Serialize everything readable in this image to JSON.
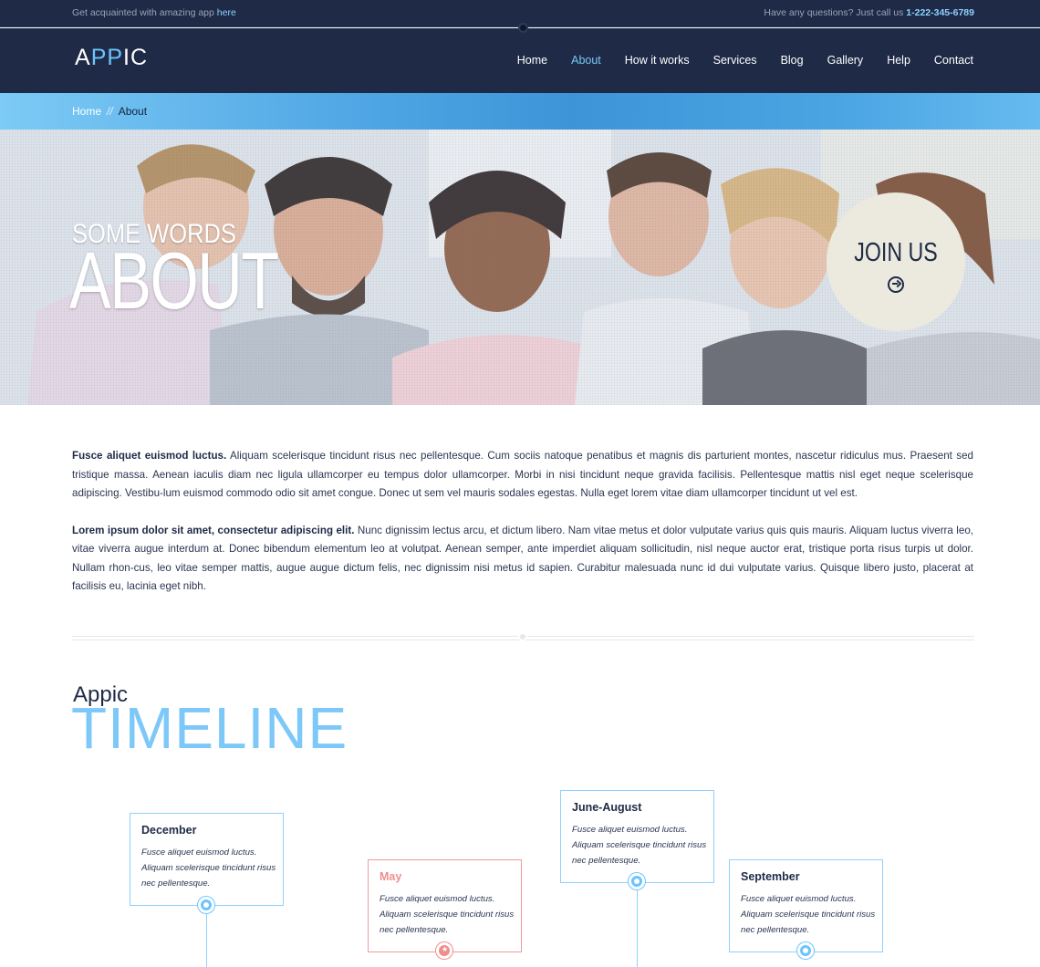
{
  "topbar": {
    "left_text": "Get acquainted with amazing app ",
    "left_link": "here",
    "right_text": "Have any questions? Just call us ",
    "phone": "1-222-345-6789"
  },
  "header": {
    "logo_a": "A",
    "logo_pp": "PP",
    "logo_ic": "IC",
    "nav": [
      "Home",
      "About",
      "How it works",
      "Services",
      "Blog",
      "Gallery",
      "Help",
      "Contact"
    ],
    "active_nav": "About"
  },
  "breadcrumb": {
    "home": "Home",
    "separator": "//",
    "current": "About"
  },
  "hero": {
    "line1": "SOME WORDS",
    "line2": "ABOUT",
    "join_label": "JOIN US",
    "join_icon": "arrow-right-circle-icon"
  },
  "content": {
    "p1_bold": "Fusce aliquet euismod luctus.",
    "p1_text": " Aliquam scelerisque tincidunt risus nec pellentesque. Cum sociis natoque penatibus et magnis dis parturient montes, nascetur ridiculus mus. Praesent sed tristique massa. Aenean iaculis diam nec ligula ullamcorper eu tempus dolor ullamcorper. Morbi in nisi tincidunt neque gravida facilisis.  Pellentesque mattis nisl eget neque scelerisque adipiscing. Vestibu-lum euismod commodo odio sit amet congue. Donec ut sem vel mauris sodales egestas. Nulla eget lorem vitae diam ullamcorper tincidunt ut vel est.",
    "p2_bold": "Lorem ipsum dolor sit amet, consectetur adipiscing elit.",
    "p2_text": " Nunc dignissim lectus arcu, et dictum libero. Nam vitae metus et dolor vulputate varius quis quis mauris. Aliquam luctus viverra leo, vitae viverra augue interdum at. Donec bibendum elementum leo at volutpat. Aenean semper, ante imperdiet aliquam sollicitudin, nisl neque auctor erat, tristique porta risus turpis ut dolor. Nullam rhon-cus, leo vitae semper mattis, augue augue dictum felis, nec dignissim nisi metus id sapien. Curabitur malesuada nunc id dui vulputate varius. Quisque libero justo, placerat at facilisis eu, lacinia eget nibh."
  },
  "timeline": {
    "small": "Appic",
    "big": "TIMELINE",
    "cards": [
      {
        "title": "December",
        "text": "Fusce aliquet euismod luctus. Aliquam scelerisque tincidunt risus nec pellentesque."
      },
      {
        "title": "May",
        "text": "Fusce aliquet euismod luctus. Aliquam scelerisque tincidunt risus nec pellentesque."
      },
      {
        "title": "June-August",
        "text": "Fusce aliquet euismod luctus. Aliquam scelerisque tincidunt risus nec pellentesque."
      },
      {
        "title": "September",
        "text": "Fusce aliquet euismod luctus. Aliquam scelerisque tincidunt risus nec pellentesque."
      }
    ]
  },
  "colors": {
    "navy": "#1e2a46",
    "accent_blue": "#7cc8f8",
    "accent_pink": "#f08c8c"
  }
}
